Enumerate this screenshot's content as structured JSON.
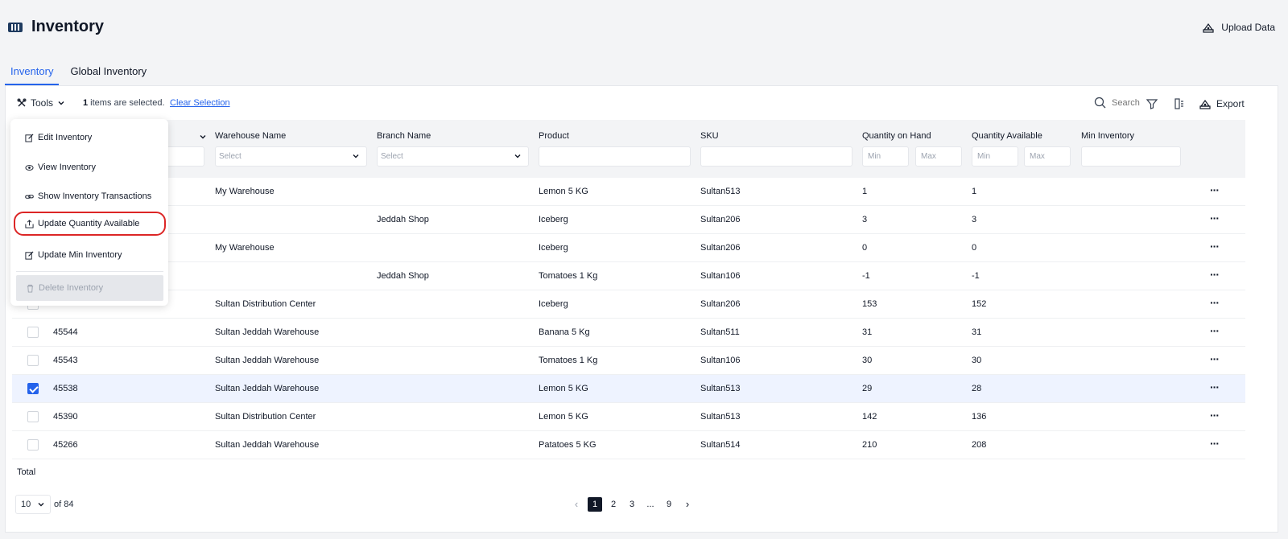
{
  "header": {
    "title": "Inventory",
    "upload_label": "Upload Data"
  },
  "tabs": [
    {
      "label": "Inventory",
      "active": true
    },
    {
      "label": "Global Inventory",
      "active": false
    }
  ],
  "toolbar": {
    "tools_label": "Tools",
    "selected_count": "1",
    "selected_text": " items are selected.",
    "clear_label": "Clear Selection",
    "search_placeholder": "Search",
    "export_label": "Export"
  },
  "columns": {
    "warehouse": "Warehouse Name",
    "branch": "Branch Name",
    "product": "Product",
    "sku": "SKU",
    "qoh": "Quantity on Hand",
    "qa": "Quantity Available",
    "min_inv": "Min Inventory"
  },
  "filters": {
    "select_placeholder": "Select",
    "min_placeholder": "Min",
    "max_placeholder": "Max"
  },
  "rows": [
    {
      "id": "",
      "warehouse": "My Warehouse",
      "branch": "",
      "product": "Lemon 5 KG",
      "sku": "Sultan513",
      "qoh": "1",
      "qa": "1",
      "checked": false
    },
    {
      "id": "",
      "warehouse": "",
      "branch": "Jeddah Shop",
      "product": "Iceberg",
      "sku": "Sultan206",
      "qoh": "3",
      "qa": "3",
      "checked": false
    },
    {
      "id": "",
      "warehouse": "My Warehouse",
      "branch": "",
      "product": "Iceberg",
      "sku": "Sultan206",
      "qoh": "0",
      "qa": "0",
      "checked": false
    },
    {
      "id": "",
      "warehouse": "",
      "branch": "Jeddah Shop",
      "product": "Tomatoes 1 Kg",
      "sku": "Sultan106",
      "qoh": "-1",
      "qa": "-1",
      "checked": false
    },
    {
      "id": "",
      "warehouse": "Sultan Distribution Center",
      "branch": "",
      "product": "Iceberg",
      "sku": "Sultan206",
      "qoh": "153",
      "qa": "152",
      "checked": false
    },
    {
      "id": "45544",
      "warehouse": "Sultan Jeddah Warehouse",
      "branch": "",
      "product": "Banana 5 Kg",
      "sku": "Sultan511",
      "qoh": "31",
      "qa": "31",
      "checked": false
    },
    {
      "id": "45543",
      "warehouse": "Sultan Jeddah Warehouse",
      "branch": "",
      "product": "Tomatoes 1 Kg",
      "sku": "Sultan106",
      "qoh": "30",
      "qa": "30",
      "checked": false
    },
    {
      "id": "45538",
      "warehouse": "Sultan Jeddah Warehouse",
      "branch": "",
      "product": "Lemon 5 KG",
      "sku": "Sultan513",
      "qoh": "29",
      "qa": "28",
      "checked": true
    },
    {
      "id": "45390",
      "warehouse": "Sultan Distribution Center",
      "branch": "",
      "product": "Lemon 5 KG",
      "sku": "Sultan513",
      "qoh": "142",
      "qa": "136",
      "checked": false
    },
    {
      "id": "45266",
      "warehouse": "Sultan Jeddah Warehouse",
      "branch": "",
      "product": "Patatoes 5 KG",
      "sku": "Sultan514",
      "qoh": "210",
      "qa": "208",
      "checked": false
    }
  ],
  "footer": {
    "total_label": "Total",
    "page_size": "10",
    "of_total": "of 84",
    "pages": [
      "1",
      "2",
      "3",
      "...",
      "9"
    ],
    "current_page": "1"
  },
  "tools_menu": [
    {
      "label": "Edit Inventory",
      "icon": "edit-icon"
    },
    {
      "label": "View Inventory",
      "icon": "eye-icon"
    },
    {
      "label": "Show Inventory Transactions",
      "icon": "link-icon"
    },
    {
      "label": "Update Quantity Available",
      "icon": "upload-box-icon",
      "highlighted": true
    },
    {
      "label": "Update Min Inventory",
      "icon": "edit-icon"
    },
    {
      "label": "Delete Inventory",
      "icon": "trash-icon",
      "disabled": true
    }
  ],
  "colors": {
    "accent": "#2563eb",
    "highlight_ring": "#dc2626",
    "selected_row": "#eef3ff"
  }
}
